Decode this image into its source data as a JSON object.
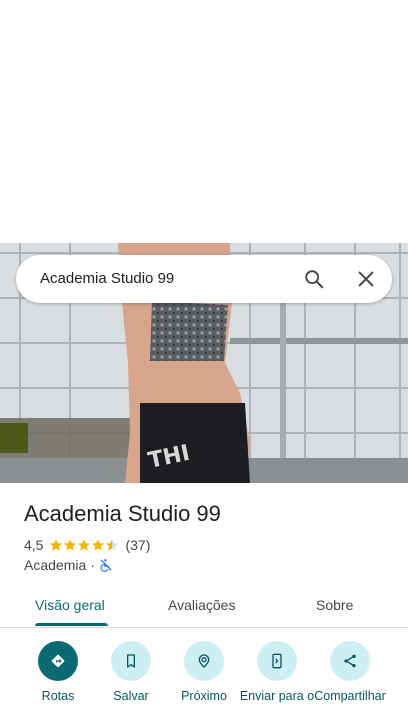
{
  "search": {
    "query": "Academia Studio 99"
  },
  "place": {
    "name": "Academia Studio 99",
    "rating": "4,5",
    "stars": 4.5,
    "review_count": "(37)",
    "category": "Academia",
    "separator": "·"
  },
  "tabs": [
    {
      "label": "Visão geral",
      "active": true
    },
    {
      "label": "Avaliações",
      "active": false
    },
    {
      "label": "Sobre",
      "active": false
    }
  ],
  "actions": [
    {
      "label": "Rotas",
      "icon": "directions-icon"
    },
    {
      "label": "Salvar",
      "icon": "bookmark-icon"
    },
    {
      "label": "Próximo",
      "icon": "nearby-icon"
    },
    {
      "label": "Enviar para o",
      "icon": "send-to-phone-icon"
    },
    {
      "label": "Compartilhar",
      "icon": "share-icon"
    }
  ],
  "colors": {
    "accent": "#0b6a74",
    "chip_bg": "#cdeff4",
    "star": "#f4b400"
  }
}
